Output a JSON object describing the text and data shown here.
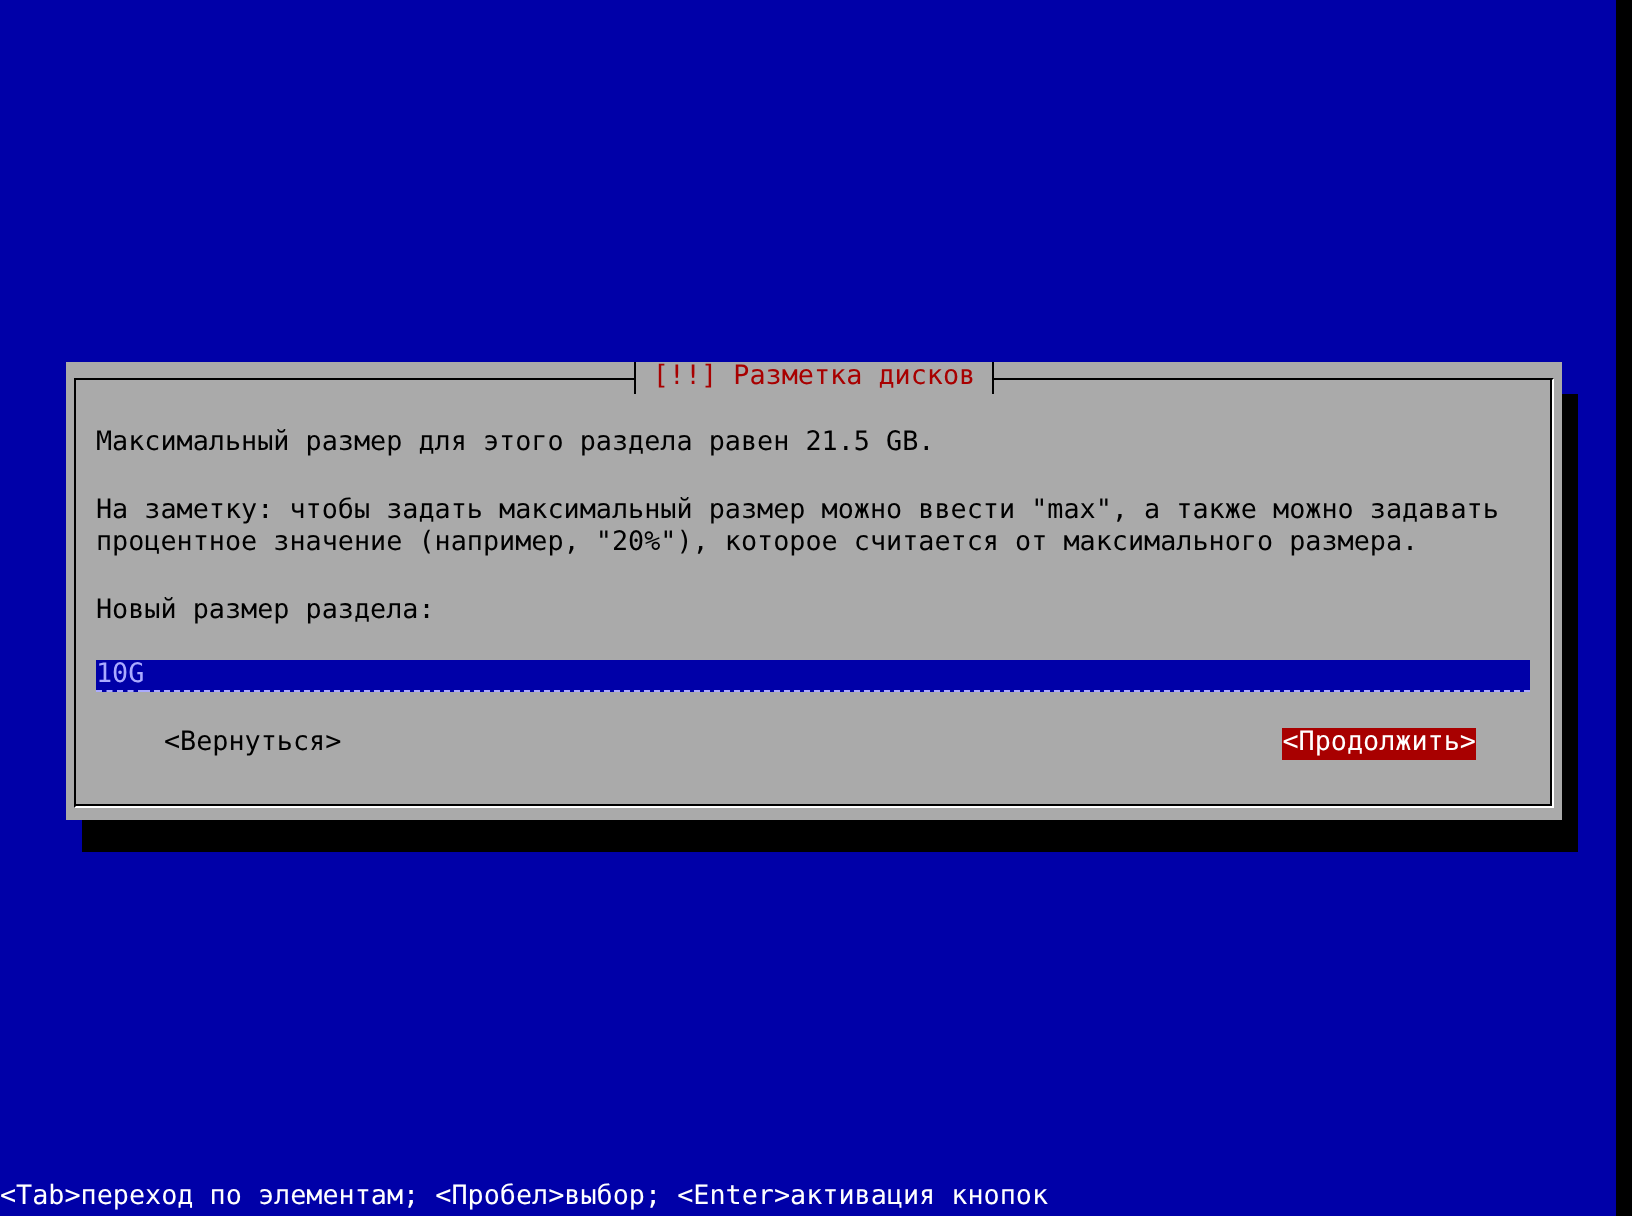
{
  "dialog": {
    "title": "[!!] Разметка дисков",
    "paragraphs": [
      "Максимальный размер для этого раздела равен 21.5 GB.",
      "На заметку: чтобы задать максимальный размер можно ввести \"max\", а также можно задавать процентное значение (например, \"20%\"), которое считается от максимального размера."
    ],
    "field": {
      "label": "Новый размер раздела:",
      "value": "10G"
    },
    "buttons": [
      {
        "label": "<Вернуться>",
        "selected": false
      },
      {
        "label": "<Продолжить>",
        "selected": true
      }
    ]
  },
  "status_bar": "<Tab>переход по элементам; <Пробел>выбор; <Enter>активация кнопок"
}
